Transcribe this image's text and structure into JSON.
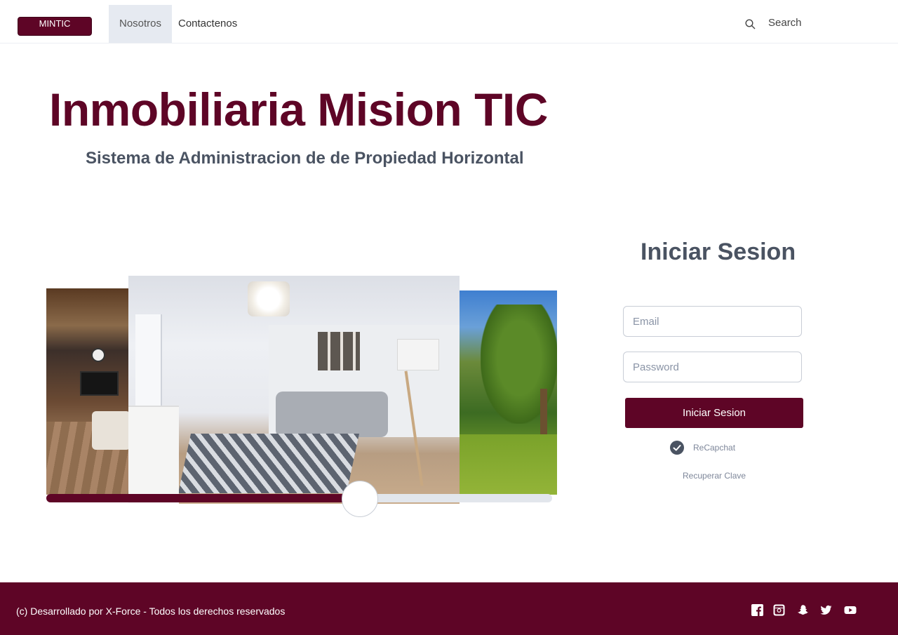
{
  "nav": {
    "brand": "MINTIC",
    "items": [
      {
        "label": "Nosotros",
        "active": true
      },
      {
        "label": "Contactenos",
        "active": false
      }
    ],
    "search_label": "Search",
    "search_icon": "search-icon"
  },
  "hero": {
    "title": "Inmobiliaria Mision TIC",
    "subtitle": "Sistema de Administracion de de Propiedad Horizontal"
  },
  "carousel": {
    "slides": [
      "living-room-left",
      "living-room-center",
      "lakeside-tree-right"
    ],
    "progress": 0.62
  },
  "login": {
    "title": "Iniciar Sesion",
    "email_placeholder": "Email",
    "password_placeholder": "Password",
    "email_value": "",
    "password_value": "",
    "submit_label": "Iniciar Sesion",
    "captcha_label": "ReCapchat",
    "captcha_checked": true,
    "recover_label": "Recuperar Clave"
  },
  "footer": {
    "text": "(c) Desarrollado por X-Force - Todos los derechos reservados",
    "social_icons": [
      "facebook-icon",
      "instagram-icon",
      "snapchat-icon",
      "twitter-icon",
      "youtube-icon"
    ]
  },
  "colors": {
    "brand": "#5e0526",
    "heading_gray": "#4a5362",
    "nav_active_bg": "#e6eaf1"
  }
}
